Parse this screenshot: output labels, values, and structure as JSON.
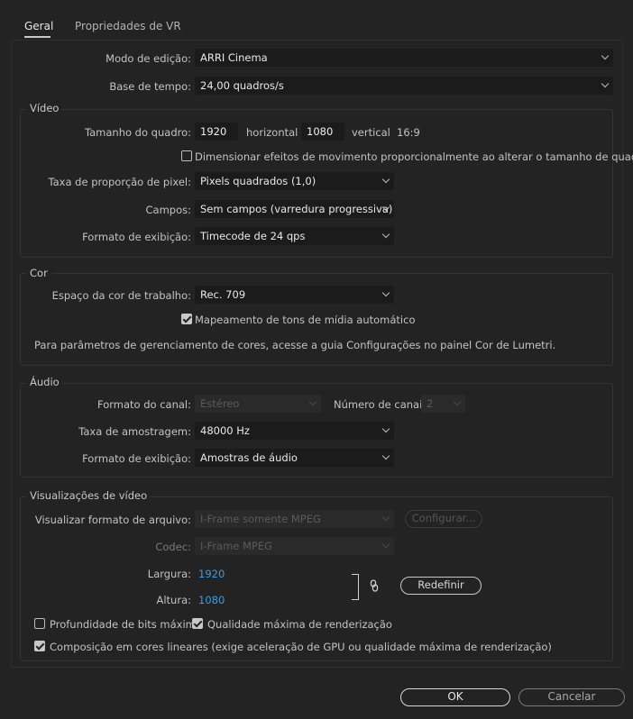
{
  "tabs": [
    {
      "label": "Geral"
    },
    {
      "label": "Propriedades de VR"
    }
  ],
  "general": {
    "edit_mode_label": "Modo de edição:",
    "edit_mode_value": "ARRI Cinema",
    "timebase_label": "Base de tempo:",
    "timebase_value": "24,00  quadros/s"
  },
  "video": {
    "title": "Vídeo",
    "frame_size_label": "Tamanho do quadro:",
    "width_value": "1920",
    "horizontal_label": "horizontal",
    "height_value": "1080",
    "vertical_label": "vertical",
    "aspect": "16:9",
    "scale_motion_label": "Dimensionar efeitos de movimento proporcionalmente ao alterar o tamanho de quadros",
    "scale_motion_checked": false,
    "pixel_aspect_label": "Taxa de proporção de pixel:",
    "pixel_aspect_value": "Pixels quadrados (1,0)",
    "fields_label": "Campos:",
    "fields_value": "Sem campos (varredura progressiva)",
    "display_format_label": "Formato de exibição:",
    "display_format_value": "Timecode de 24 qps"
  },
  "color": {
    "title": "Cor",
    "working_space_label": "Espaço da cor de trabalho:",
    "working_space_value": "Rec. 709",
    "tone_map_label": "Mapeamento de tons de mídia automático",
    "tone_map_checked": true,
    "info_text": "Para parâmetros de gerenciamento de cores, acesse a guia Configurações no painel Cor de Lumetri."
  },
  "audio": {
    "title": "Áudio",
    "channel_format_label": "Formato do canal:",
    "channel_format_value": "Estéreo",
    "num_channels_label": "Número de canais:",
    "num_channels_value": "2",
    "sample_rate_label": "Taxa de amostragem:",
    "sample_rate_value": "48000 Hz",
    "display_format_label": "Formato de exibição:",
    "display_format_value": "Amostras de áudio"
  },
  "previews": {
    "title": "Visualizações de vídeo",
    "file_format_label": "Visualizar formato de arquivo:",
    "file_format_value": "I-Frame somente MPEG",
    "configure_label": "Configurar...",
    "codec_label": "Codec:",
    "codec_value": "I-Frame MPEG",
    "width_label": "Largura:",
    "width_value": "1920",
    "height_label": "Altura:",
    "height_value": "1080",
    "reset_label": "Redefinir",
    "max_bit_depth_label": "Profundidade de bits máxima",
    "max_bit_depth_checked": false,
    "max_render_quality_label": "Qualidade máxima de renderização",
    "max_render_quality_checked": true,
    "linear_color_label": "Composição em cores lineares (exige aceleração de GPU ou qualidade máxima de renderização)",
    "linear_color_checked": true
  },
  "footer": {
    "ok_label": "OK",
    "cancel_label": "Cancelar"
  },
  "icons": {
    "link": "link-icon",
    "chevron": "chevron-down-icon",
    "checkbox_checked": "checkmark-icon"
  },
  "colors": {
    "background": "#232323",
    "field_bg": "#1b1b1b",
    "accent_blue": "#3a9de8"
  }
}
